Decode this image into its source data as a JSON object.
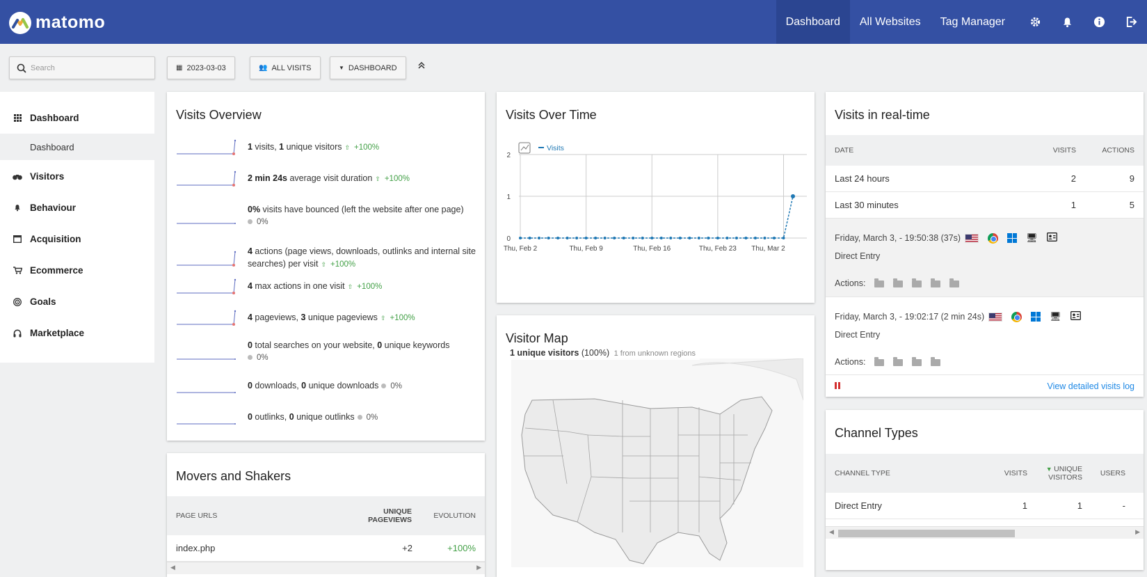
{
  "topbar": {
    "brand": "matomo",
    "nav": [
      "Dashboard",
      "All Websites",
      "Tag Manager"
    ],
    "icons": [
      "gear-icon",
      "bell-icon",
      "info-icon",
      "logout-icon"
    ]
  },
  "controls": {
    "search_placeholder": "Search",
    "date": "2023-03-03",
    "segment": "ALL VISITS",
    "dashboard": "DASHBOARD"
  },
  "sidebar": {
    "items": [
      {
        "label": "Dashboard",
        "icon": "grid-icon"
      },
      {
        "label": "Visitors",
        "icon": "binoculars-icon"
      },
      {
        "label": "Behaviour",
        "icon": "bell-icon"
      },
      {
        "label": "Acquisition",
        "icon": "window-icon"
      },
      {
        "label": "Ecommerce",
        "icon": "cart-icon"
      },
      {
        "label": "Goals",
        "icon": "target-icon"
      },
      {
        "label": "Marketplace",
        "icon": "headphones-icon"
      }
    ],
    "sub_item": "Dashboard"
  },
  "visits_overview": {
    "title": "Visits Overview",
    "rows": [
      {
        "a": "1",
        "b": " visits, ",
        "c": "1",
        "d": " unique visitors",
        "change": "+100%",
        "up": true
      },
      {
        "a": "2 min 24s",
        "b": " average visit duration",
        "c": "",
        "d": "",
        "change": "+100%",
        "up": true
      },
      {
        "a": "0%",
        "b": " visits have bounced (left the website after one page)",
        "c": "",
        "d": "",
        "change": "0%",
        "up": false
      },
      {
        "a": "4",
        "b": " actions (page views, downloads, outlinks and internal site searches) per visit",
        "c": "",
        "d": "",
        "change": "+100%",
        "up": true
      },
      {
        "a": "4",
        "b": " max actions in one visit",
        "c": "",
        "d": "",
        "change": "+100%",
        "up": true
      },
      {
        "a": "4",
        "b": " pageviews, ",
        "c": "3",
        "d": " unique pageviews",
        "change": "+100%",
        "up": true
      },
      {
        "a": "0",
        "b": " total searches on your website, ",
        "c": "0",
        "d": " unique keywords",
        "change": "0%",
        "up": false
      },
      {
        "a": "0",
        "b": " downloads, ",
        "c": "0",
        "d": " unique downloads",
        "change": "0%",
        "up": false
      },
      {
        "a": "0",
        "b": " outlinks, ",
        "c": "0",
        "d": " unique outlinks",
        "change": "0%",
        "up": false
      }
    ]
  },
  "movers": {
    "title": "Movers and Shakers",
    "headers": [
      "PAGE URLS",
      "UNIQUE PAGEVIEWS",
      "EVOLUTION"
    ],
    "rows": [
      {
        "url": "index.php",
        "value": "+2",
        "evolution": "+100%"
      }
    ]
  },
  "visits_over_time": {
    "title": "Visits Over Time",
    "legend": "Visits"
  },
  "chart_data": {
    "type": "line",
    "title": "",
    "xlabel": "",
    "ylabel": "",
    "ylim": [
      0,
      2
    ],
    "yticks": [
      "0",
      "1",
      "2"
    ],
    "xticks": [
      "Thu, Feb 2",
      "Thu, Feb 9",
      "Thu, Feb 16",
      "Thu, Feb 23",
      "Thu, Mar 2"
    ],
    "series": [
      {
        "name": "Visits",
        "values": [
          0,
          0,
          0,
          0,
          0,
          0,
          0,
          0,
          0,
          0,
          0,
          0,
          0,
          0,
          0,
          0,
          0,
          0,
          0,
          0,
          0,
          0,
          0,
          0,
          0,
          0,
          0,
          0,
          0,
          1
        ]
      }
    ]
  },
  "visitor_map": {
    "title": "Visitor Map",
    "summary_bold": "1 unique visitors",
    "summary_pct": " (100%)",
    "summary_note": "1 from unknown regions"
  },
  "realtime": {
    "title": "Visits in real-time",
    "headers": [
      "DATE",
      "VISITS",
      "ACTIONS"
    ],
    "rows": [
      {
        "label": "Last 24 hours",
        "visits": "2",
        "actions": "9"
      },
      {
        "label": "Last 30 minutes",
        "visits": "1",
        "actions": "5"
      }
    ],
    "visits": [
      {
        "time": "Friday, March 3, - 19:50:38 (37s)",
        "referrer": "Direct Entry",
        "actions_label": "Actions:",
        "action_count": 5
      },
      {
        "time": "Friday, March 3, - 19:02:17 (2 min 24s)",
        "referrer": "Direct Entry",
        "actions_label": "Actions:",
        "action_count": 4
      }
    ],
    "log_link": "View detailed visits log"
  },
  "channels": {
    "title": "Channel Types",
    "headers": [
      "CHANNEL TYPE",
      "VISITS",
      "UNIQUE VISITORS",
      "USERS"
    ],
    "rows": [
      {
        "type": "Direct Entry",
        "visits": "1",
        "unique": "1",
        "users": "-"
      }
    ]
  }
}
